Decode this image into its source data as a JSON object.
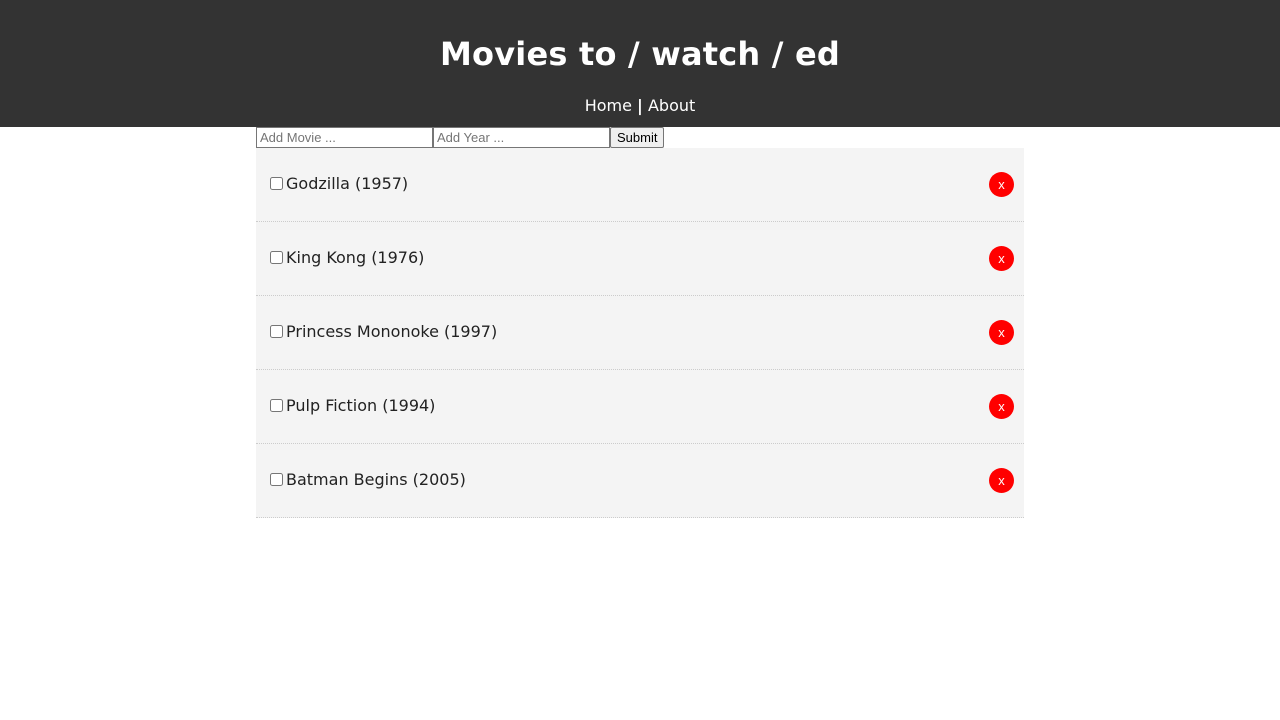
{
  "header": {
    "title": "Movies to / watch / ed",
    "nav": {
      "home": "Home",
      "separator": "|",
      "about": "About"
    }
  },
  "form": {
    "movie_placeholder": "Add Movie ...",
    "year_placeholder": "Add Year ...",
    "submit_label": "Submit"
  },
  "movies": [
    {
      "label": "Godzilla (1957)",
      "checked": false,
      "delete_label": "x"
    },
    {
      "label": "King Kong (1976)",
      "checked": false,
      "delete_label": "x"
    },
    {
      "label": "Princess Mononoke (1997)",
      "checked": false,
      "delete_label": "x"
    },
    {
      "label": "Pulp Fiction (1994)",
      "checked": false,
      "delete_label": "x"
    },
    {
      "label": "Batman Begins (2005)",
      "checked": false,
      "delete_label": "x"
    }
  ],
  "colors": {
    "header_bg": "#333333",
    "item_bg": "#f4f4f4",
    "delete_bg": "#ff0000"
  }
}
